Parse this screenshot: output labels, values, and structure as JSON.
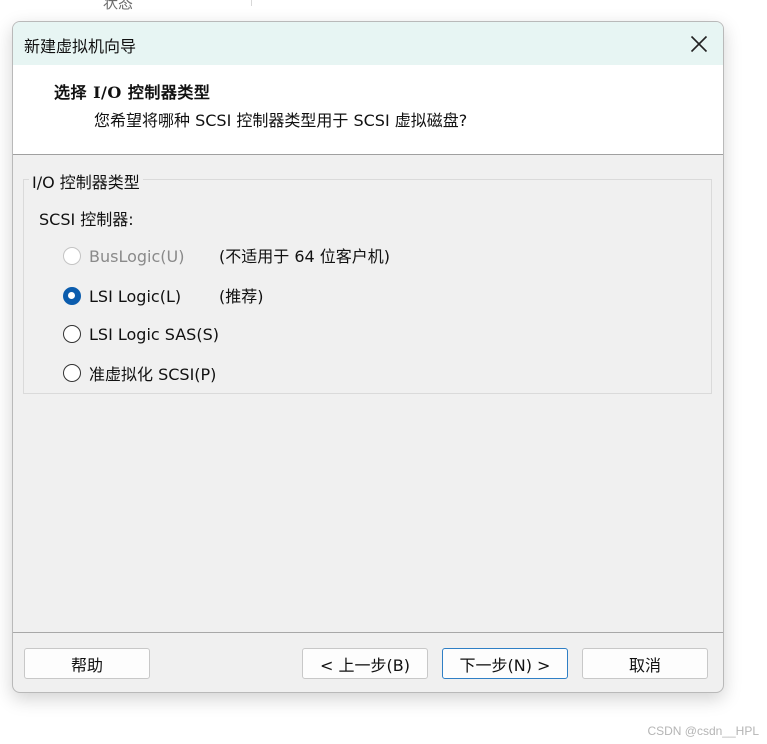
{
  "background": {
    "partial_text": "状态",
    "watermark": "CSDN @csdn__HPL"
  },
  "dialog": {
    "title": "新建虚拟机向导",
    "close_icon": "close-icon",
    "header": {
      "title": "选择 I/O 控制器类型",
      "subtitle": "您希望将哪种 SCSI 控制器类型用于 SCSI 虚拟磁盘?"
    },
    "group": {
      "legend": "I/O 控制器类型",
      "scsi_label": "SCSI 控制器:",
      "options": [
        {
          "label": "BusLogic(U)",
          "note": "(不适用于 64 位客户机)",
          "checked": false,
          "disabled": true
        },
        {
          "label": "LSI Logic(L)",
          "note": "(推荐)",
          "checked": true,
          "disabled": false
        },
        {
          "label": "LSI Logic SAS(S)",
          "note": "",
          "checked": false,
          "disabled": false
        },
        {
          "label": "准虚拟化 SCSI(P)",
          "note": "",
          "checked": false,
          "disabled": false
        }
      ]
    },
    "buttons": {
      "help": "帮助",
      "back": "< 上一步(B)",
      "next": "下一步(N) >",
      "cancel": "取消"
    },
    "colors": {
      "titlebar": "#e7f5f3",
      "accent": "#0b5cad",
      "window_bg": "#f0f0f0"
    }
  }
}
